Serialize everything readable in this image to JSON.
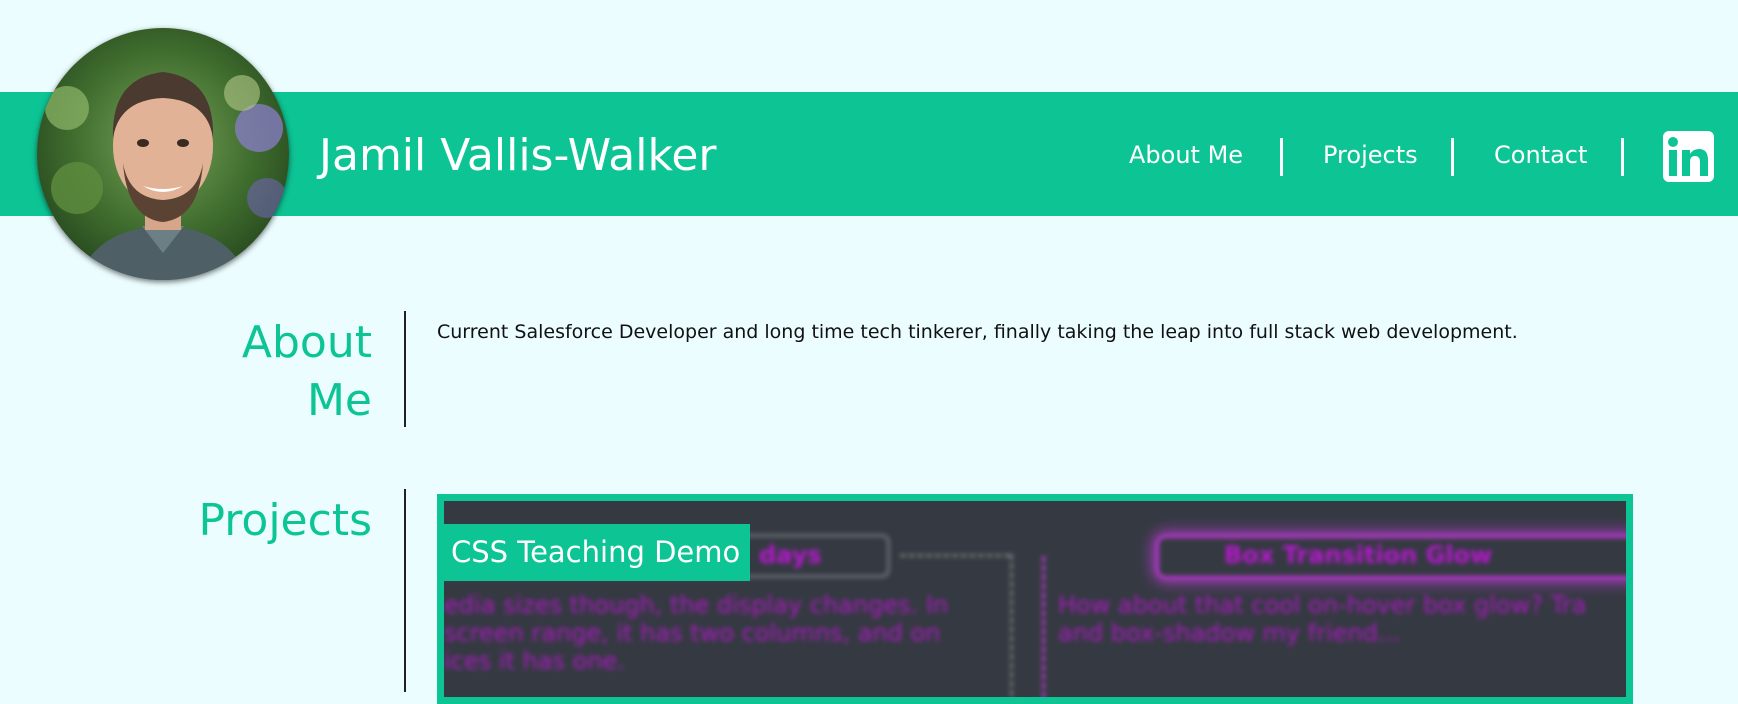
{
  "header": {
    "site_title": "Jamil Vallis-Walker",
    "nav": [
      {
        "label": "About Me"
      },
      {
        "label": "Projects"
      },
      {
        "label": "Contact"
      }
    ],
    "social_icon": "linkedin-icon",
    "social_text": "in"
  },
  "about": {
    "heading_line1": "About",
    "heading_line2": "Me",
    "text": "Current Salesforce Developer and long time tech tinkerer, finally taking the leap into full stack web development."
  },
  "projects": {
    "heading": "Projects",
    "items": [
      {
        "title": "CSS Teaching Demo",
        "preview": {
          "left_heading": "days",
          "left_body": [
            "edia sizes though, the display changes. In",
            "screen range, it has two columns, and on",
            "ices it has one."
          ],
          "right_heading": "Box Transition Glow",
          "right_body": [
            "How about that cool on-hover box glow? Tra",
            "and box-shadow my friend..."
          ]
        }
      }
    ]
  },
  "colors": {
    "accent": "#0dc495",
    "background": "#ebfdff",
    "preview_bg": "#353a42",
    "preview_text": "#b718cf"
  }
}
